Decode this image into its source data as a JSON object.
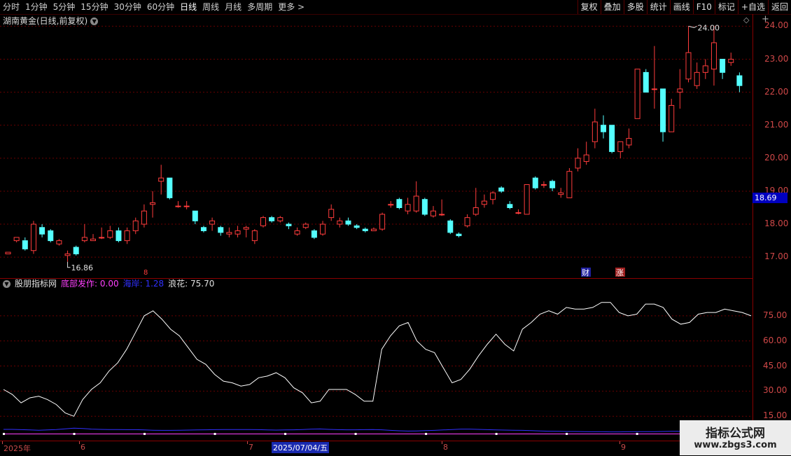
{
  "toolbar": {
    "tabs": [
      "分时",
      "1分钟",
      "5分钟",
      "15分钟",
      "30分钟",
      "60分钟",
      "日线",
      "周线",
      "月线",
      "多周期"
    ],
    "active_tab": "日线",
    "more_label": "更多 >",
    "tools": [
      "复权",
      "叠加",
      "多股",
      "统计",
      "画线",
      "F10",
      "标记",
      "+自选",
      "返回"
    ]
  },
  "stock": {
    "title": "湖南黄金(日线,前复权)",
    "current_price": "18.69",
    "high_label": "24.00",
    "low_label": "16.86"
  },
  "colors": {
    "up": "#ff3c3c",
    "down": "#54ffff",
    "bg": "#000000",
    "grid": "#8a0000",
    "line": "#ffffff",
    "blue": "#3030ff",
    "magenta": "#ff40ff"
  },
  "price_axis": [
    "24.00",
    "23.00",
    "22.00",
    "21.00",
    "20.00",
    "19.00",
    "18.00",
    "17.00"
  ],
  "markers": {
    "cai": "财",
    "zhang": "涨",
    "flag": "8"
  },
  "indicator": {
    "name": "股朋指标网",
    "items": [
      {
        "label": "底部发作: 0.00",
        "color": "#ff40ff"
      },
      {
        "label": "海岸: 1.28",
        "color": "#3030ff"
      },
      {
        "label": "浪花: 75.70",
        "color": "#e0e0e0"
      }
    ],
    "axis": [
      "75.00",
      "60.00",
      "45.00",
      "30.00",
      "15.00"
    ]
  },
  "dates": {
    "labels": [
      {
        "text": "2025年",
        "pos": "start"
      },
      {
        "text": "6"
      },
      {
        "text": "7"
      },
      {
        "text": "8"
      },
      {
        "text": "9"
      }
    ],
    "selected": "2025/07/04/五"
  },
  "watermark": {
    "title": "指标公式网",
    "url": "www.zbgs3.com"
  },
  "chart_data": {
    "type": "candlestick",
    "y_range": [
      16.6,
      24.2
    ],
    "candles": [
      [
        17.1,
        17.15,
        17.1,
        17.15
      ],
      [
        17.5,
        17.6,
        17.45,
        17.55
      ],
      [
        17.5,
        17.25,
        17.6,
        17.2
      ],
      [
        17.2,
        18.0,
        18.1,
        17.1
      ],
      [
        17.9,
        17.7,
        18.0,
        17.6
      ],
      [
        17.8,
        17.5,
        17.85,
        17.45
      ],
      [
        17.4,
        17.5,
        17.55,
        17.35
      ],
      [
        17.05,
        17.1,
        17.2,
        16.86
      ],
      [
        17.3,
        17.1,
        17.35,
        17.05
      ],
      [
        17.5,
        17.6,
        18.0,
        17.45
      ],
      [
        17.5,
        17.55,
        17.7,
        17.5
      ],
      [
        17.6,
        17.6,
        17.9,
        17.55
      ],
      [
        17.6,
        17.8,
        17.95,
        17.55
      ],
      [
        17.8,
        17.5,
        17.9,
        17.45
      ],
      [
        17.5,
        17.8,
        17.9,
        17.4
      ],
      [
        17.8,
        18.1,
        18.2,
        17.7
      ],
      [
        18.0,
        18.4,
        18.6,
        17.9
      ],
      [
        18.6,
        18.65,
        19.0,
        18.2
      ],
      [
        19.3,
        19.4,
        19.8,
        18.9
      ],
      [
        19.4,
        18.8,
        19.4,
        18.75
      ],
      [
        18.55,
        18.55,
        18.7,
        18.5
      ],
      [
        18.55,
        18.55,
        18.7,
        18.45
      ],
      [
        18.4,
        18.1,
        18.4,
        18.0
      ],
      [
        17.9,
        17.8,
        17.95,
        17.75
      ],
      [
        18.0,
        18.1,
        18.2,
        17.8
      ],
      [
        17.9,
        17.75,
        17.95,
        17.65
      ],
      [
        17.7,
        17.75,
        17.9,
        17.6
      ],
      [
        17.7,
        17.8,
        17.95,
        17.6
      ],
      [
        17.85,
        17.9,
        17.95,
        17.6
      ],
      [
        17.5,
        17.8,
        17.85,
        17.4
      ],
      [
        17.95,
        18.2,
        18.25,
        17.9
      ],
      [
        18.2,
        18.1,
        18.25,
        18.05
      ],
      [
        18.1,
        18.2,
        18.25,
        18.05
      ],
      [
        18.0,
        17.95,
        18.05,
        17.85
      ],
      [
        17.7,
        17.8,
        17.9,
        17.65
      ],
      [
        17.9,
        18.0,
        18.05,
        17.85
      ],
      [
        17.8,
        17.6,
        17.85,
        17.55
      ],
      [
        17.7,
        18.0,
        18.1,
        17.65
      ],
      [
        18.2,
        18.45,
        18.6,
        18.1
      ],
      [
        18.0,
        18.1,
        18.2,
        17.9
      ],
      [
        18.1,
        18.0,
        18.2,
        17.95
      ],
      [
        17.95,
        17.9,
        18.0,
        17.85
      ],
      [
        17.85,
        17.8,
        17.9,
        17.75
      ],
      [
        17.8,
        17.85,
        17.9,
        17.8
      ],
      [
        17.85,
        18.3,
        18.35,
        17.8
      ],
      [
        18.6,
        18.6,
        18.7,
        18.5
      ],
      [
        18.75,
        18.5,
        18.8,
        18.45
      ],
      [
        18.4,
        18.6,
        18.8,
        18.3
      ],
      [
        18.4,
        18.85,
        19.3,
        18.35
      ],
      [
        18.75,
        18.3,
        18.8,
        18.25
      ],
      [
        18.25,
        18.4,
        18.55,
        18.2
      ],
      [
        18.3,
        18.3,
        18.75,
        18.25
      ],
      [
        18.1,
        17.75,
        18.15,
        17.7
      ],
      [
        17.7,
        17.65,
        17.75,
        17.6
      ],
      [
        17.95,
        18.2,
        18.3,
        17.9
      ],
      [
        18.3,
        18.5,
        19.1,
        18.25
      ],
      [
        18.6,
        18.7,
        18.9,
        18.5
      ],
      [
        18.75,
        18.95,
        19.0,
        18.6
      ],
      [
        19.1,
        19.0,
        19.15,
        18.95
      ],
      [
        18.6,
        18.5,
        18.7,
        18.45
      ],
      [
        18.35,
        18.35,
        18.45,
        18.3
      ],
      [
        18.3,
        19.2,
        19.2,
        18.3
      ],
      [
        19.4,
        19.1,
        19.45,
        19.05
      ],
      [
        19.2,
        19.2,
        19.3,
        19.1
      ],
      [
        19.3,
        19.1,
        19.35,
        19.0
      ],
      [
        18.9,
        18.95,
        19.1,
        18.8
      ],
      [
        18.8,
        19.6,
        19.7,
        18.8
      ],
      [
        19.7,
        20.0,
        20.3,
        19.6
      ],
      [
        19.9,
        20.1,
        20.5,
        19.8
      ],
      [
        20.5,
        21.1,
        21.5,
        20.3
      ],
      [
        21.0,
        20.8,
        21.3,
        20.6
      ],
      [
        21.0,
        20.2,
        21.0,
        20.15
      ],
      [
        20.2,
        20.5,
        20.5,
        20.0
      ],
      [
        20.4,
        20.6,
        20.9,
        20.3
      ],
      [
        21.2,
        22.7,
        22.7,
        21.2
      ],
      [
        22.6,
        22.0,
        22.7,
        22.0
      ],
      [
        22.1,
        22.1,
        23.4,
        21.5
      ],
      [
        22.1,
        20.8,
        22.1,
        20.5
      ],
      [
        20.8,
        21.6,
        21.8,
        20.8
      ],
      [
        22.0,
        22.1,
        22.7,
        21.5
      ],
      [
        22.4,
        23.2,
        24.0,
        22.3
      ],
      [
        22.2,
        22.6,
        22.9,
        22.1
      ],
      [
        22.6,
        22.8,
        23.0,
        22.4
      ],
      [
        22.7,
        23.5,
        24.0,
        22.2
      ],
      [
        23.0,
        22.6,
        23.0,
        22.4
      ],
      [
        22.9,
        23.0,
        23.2,
        22.8
      ],
      [
        22.5,
        22.2,
        22.6,
        22.0
      ]
    ],
    "indicator_series": {
      "name": "浪花",
      "values": [
        31,
        28,
        23,
        26,
        27,
        25,
        22,
        17,
        15,
        25,
        31,
        35,
        42,
        47,
        55,
        65,
        75,
        78,
        73,
        67,
        63,
        56,
        49,
        46,
        40,
        36,
        35,
        33,
        34,
        38,
        39,
        41,
        38,
        32,
        29,
        23,
        24,
        31,
        31,
        31,
        28,
        24,
        24,
        55,
        63,
        69,
        71,
        60,
        55,
        53,
        44,
        35,
        37,
        43,
        51,
        58,
        64,
        58,
        54,
        67,
        71,
        76,
        78,
        76,
        80,
        79,
        79,
        80,
        83,
        83,
        77,
        75,
        76,
        82,
        82,
        80,
        73,
        70,
        71,
        76,
        77,
        77,
        79,
        78,
        77,
        75
      ]
    },
    "hailan_series": {
      "name": "海岸",
      "values": [
        3.0,
        3.0,
        2.8,
        2.6,
        2.4,
        2.6,
        2.9,
        3.4,
        3.9,
        3.6,
        3.2,
        3.0,
        2.9,
        2.9,
        2.8,
        2.8,
        2.6,
        2.4,
        2.3,
        2.3,
        2.4,
        2.5,
        2.6,
        2.7,
        2.8,
        2.9,
        2.9,
        2.9,
        2.9,
        2.8,
        2.6,
        2.5,
        2.6,
        2.7,
        2.9,
        3.2,
        3.3,
        3.0,
        2.8,
        2.7,
        2.7,
        2.8,
        2.9,
        2.7,
        2.3,
        2.0,
        1.8,
        1.9,
        2.1,
        2.3,
        2.6,
        2.9,
        3.2,
        3.2,
        3.0,
        2.8,
        2.6,
        2.5,
        2.4,
        2.3,
        2.1,
        1.9,
        1.7,
        1.6,
        1.5,
        1.5,
        1.4,
        1.3,
        1.3,
        1.2,
        1.2,
        1.3,
        1.4,
        1.4,
        1.4,
        1.5,
        1.6,
        1.6,
        1.5,
        1.5,
        1.4,
        1.3,
        1.3,
        1.3,
        1.3,
        1.28
      ]
    },
    "ylabel": ""
  }
}
